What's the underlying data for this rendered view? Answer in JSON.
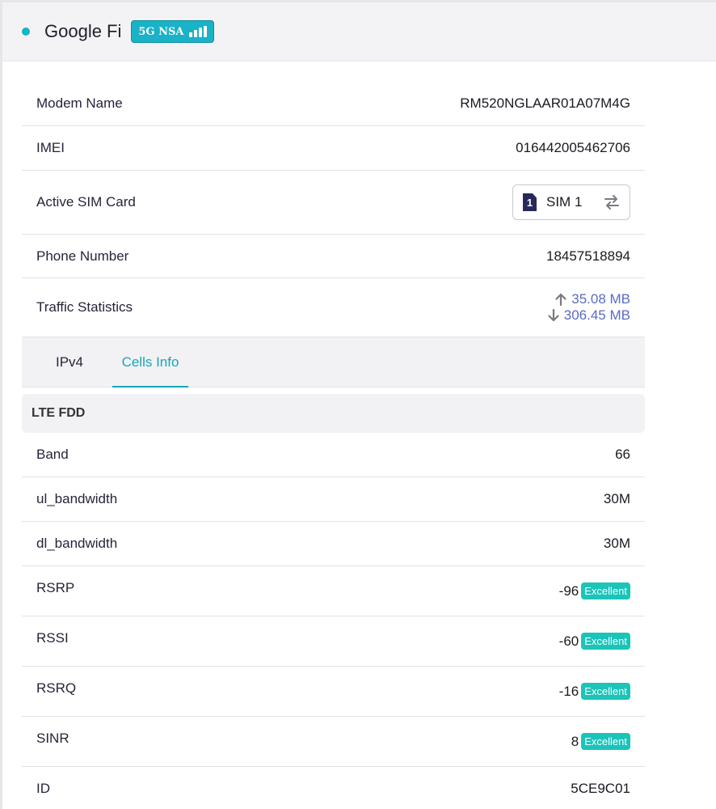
{
  "header": {
    "carrier": "Google Fi",
    "network_badge": "5G NSA",
    "status_color": "#11b5c4",
    "accent_color": "#19b2c6",
    "signal_level": 4,
    "signal_max": 4
  },
  "info": {
    "modem_name": {
      "label": "Modem Name",
      "value": "RM520NGLAAR01A07M4G"
    },
    "imei": {
      "label": "IMEI",
      "value": "016442005462706"
    },
    "sim": {
      "label": "Active SIM Card",
      "slot": "1",
      "value": "SIM 1",
      "icon": "swap-icon"
    },
    "phone": {
      "label": "Phone Number",
      "value": "18457518894"
    },
    "traffic": {
      "label": "Traffic Statistics",
      "upload": "35.08 MB",
      "download": "306.45 MB"
    }
  },
  "tabs": [
    {
      "label": "IPv4",
      "active": false
    },
    {
      "label": "Cells Info",
      "active": true
    }
  ],
  "cells": {
    "section_title": "LTE FDD",
    "band": {
      "label": "Band",
      "value": "66"
    },
    "ul_bandwidth": {
      "label": "ul_bandwidth",
      "value": "30M"
    },
    "dl_bandwidth": {
      "label": "dl_bandwidth",
      "value": "30M"
    },
    "rsrp": {
      "label": "RSRP",
      "value": "-96",
      "quality": "Excellent"
    },
    "rssi": {
      "label": "RSSI",
      "value": "-60",
      "quality": "Excellent"
    },
    "rsrq": {
      "label": "RSRQ",
      "value": "-16",
      "quality": "Excellent"
    },
    "sinr": {
      "label": "SINR",
      "value": "8",
      "quality": "Excellent"
    },
    "id": {
      "label": "ID",
      "value": "5CE9C01"
    },
    "quality_color": "#1bc4b8"
  }
}
